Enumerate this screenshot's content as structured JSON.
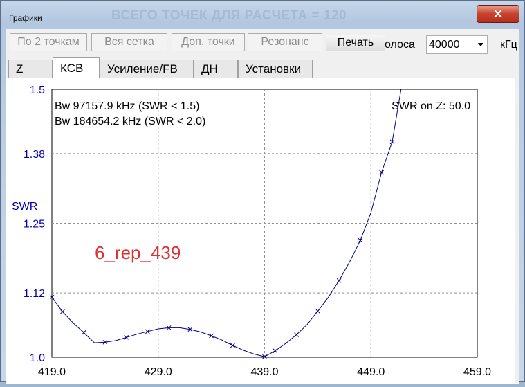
{
  "window": {
    "title": "Графики",
    "ghost_title": "ВСЕГО ТОЧЕК ДЛЯ РАСЧЕТА = 120",
    "close_glyph": "✕"
  },
  "toolbar": {
    "buttons": [
      "По 2 точкам",
      "Вся сетка",
      "Доп. точки",
      "Резонанс",
      "Печать"
    ],
    "band_label": "олоса",
    "band_value": "40000",
    "unit_label": "кГц"
  },
  "tabs": [
    "Z",
    "КСВ",
    "Усиление/FB",
    "ДН",
    "Установки"
  ],
  "selected_tab": "КСВ",
  "colors": {
    "curve": "#00007f",
    "axis_text": "#0000b0",
    "annotation": "#e03030",
    "grid": "#909090"
  },
  "chart_data": {
    "type": "line",
    "ylabel": "SWR",
    "x_ticks": [
      "419.0",
      "429.0",
      "439.0",
      "449.0",
      "459.0"
    ],
    "y_ticks": [
      "1.0",
      "1.12",
      "1.25",
      "1.38",
      "1.5"
    ],
    "xlim": [
      419,
      459
    ],
    "ylim": [
      1.0,
      1.5
    ],
    "info_lines": [
      "Bw 97157.9 kHz (SWR < 1.5)",
      "Bw 184654.2 kHz (SWR < 2.0)"
    ],
    "swr_z": "SWR on Z: 50.0",
    "annotation": "6_rep_439",
    "grid": true,
    "series": [
      {
        "x": [
          419,
          420,
          421,
          422,
          423,
          424,
          425,
          426,
          427,
          428,
          429,
          430,
          431,
          432,
          433,
          434,
          435,
          436,
          437,
          438,
          439,
          440,
          441,
          442,
          443,
          444,
          445,
          446,
          447,
          448,
          449,
          450,
          451,
          452
        ],
        "y": [
          1.112,
          1.085,
          1.064,
          1.046,
          1.027,
          1.028,
          1.031,
          1.037,
          1.043,
          1.048,
          1.053,
          1.055,
          1.055,
          1.052,
          1.047,
          1.04,
          1.032,
          1.022,
          1.013,
          1.006,
          1.001,
          1.012,
          1.026,
          1.042,
          1.061,
          1.086,
          1.112,
          1.143,
          1.178,
          1.218,
          1.27,
          1.345,
          1.402,
          1.52
        ],
        "markers_x": [
          419,
          420,
          421,
          422,
          423,
          424,
          425,
          426,
          427,
          428,
          429,
          430,
          431,
          432,
          433,
          434,
          435,
          436,
          437,
          438,
          439,
          440,
          441,
          442,
          443,
          444,
          445,
          446,
          447,
          448,
          449,
          450,
          451
        ],
        "marker_indices": [
          0,
          1,
          3,
          5,
          7,
          9,
          11,
          13,
          15,
          17,
          20,
          21,
          23,
          25,
          27,
          29,
          31,
          32
        ]
      }
    ]
  }
}
